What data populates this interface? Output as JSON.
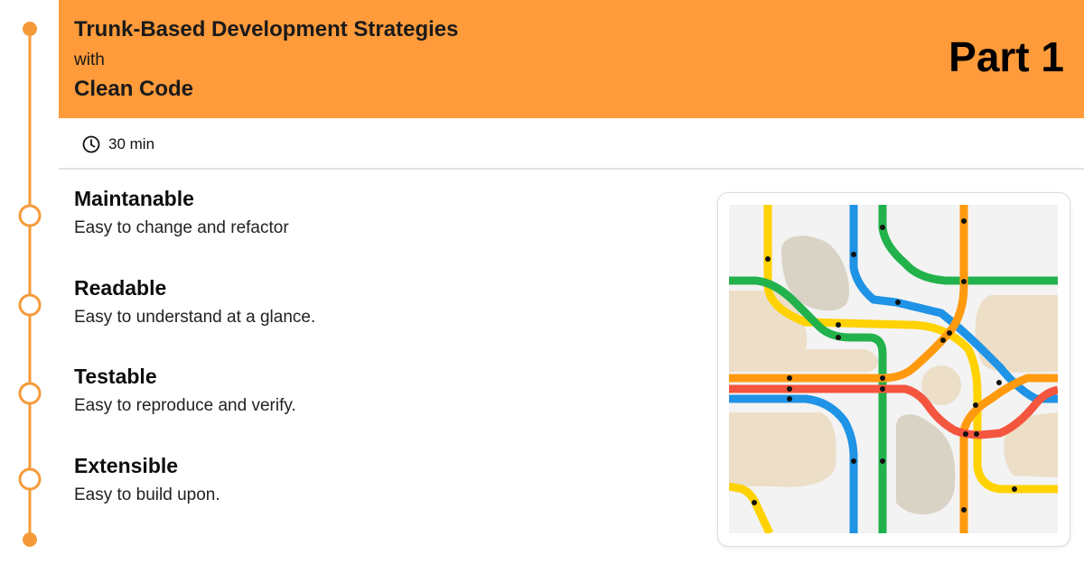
{
  "header": {
    "title_line1": "Trunk-Based Development Strategies",
    "title_line2": "with",
    "title_line3": "Clean Code",
    "part_label": "Part 1",
    "background_color": "#ff9b3b"
  },
  "meta": {
    "icon": "clock-icon",
    "duration": "30 min"
  },
  "items": [
    {
      "title": "Maintanable",
      "description": "Easy to change and refactor"
    },
    {
      "title": "Readable",
      "description": "Easy to understand at a glance."
    },
    {
      "title": "Testable",
      "description": "Easy to reproduce and verify."
    },
    {
      "title": "Extensible",
      "description": "Easy to build upon."
    }
  ],
  "timeline": {
    "color": "#f59a3a"
  },
  "illustration": {
    "icon": "subway-map-illustration",
    "line_colors": [
      "#ffd200",
      "#1f93e6",
      "#22b24c",
      "#ff9a0f",
      "#f4553e"
    ]
  }
}
